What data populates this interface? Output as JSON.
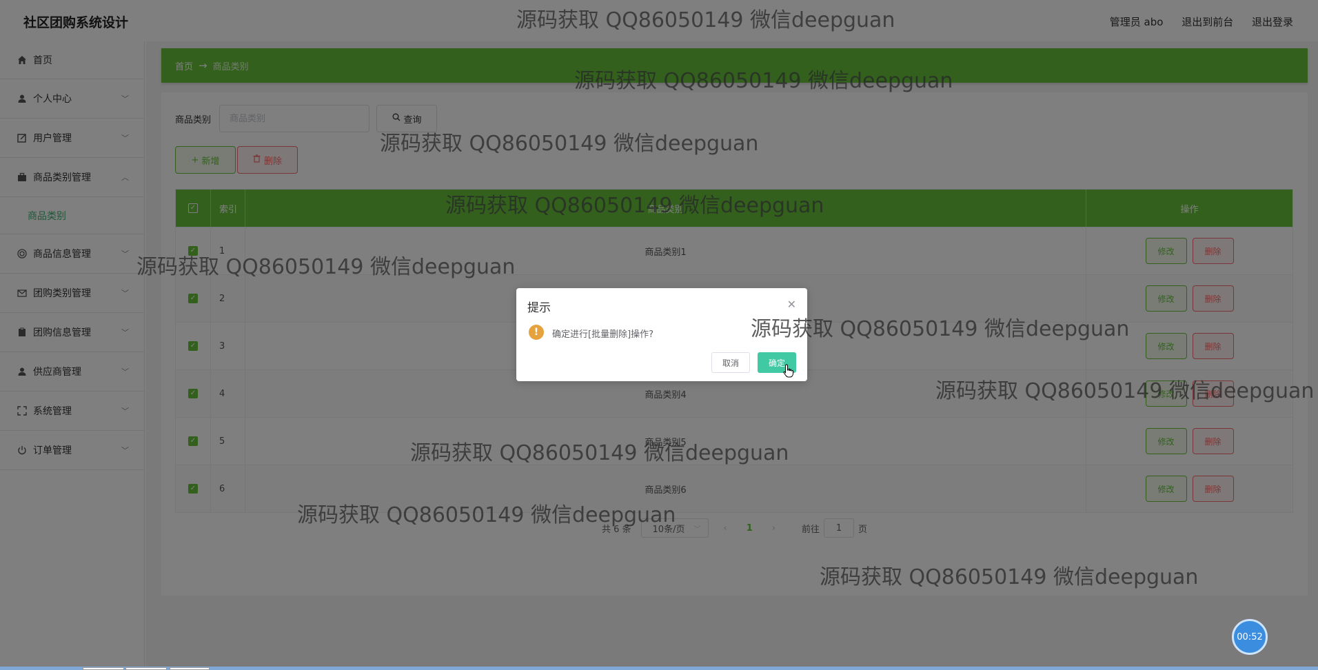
{
  "header": {
    "brand": "社区团购系统设计",
    "admin": "管理员 abo",
    "to_front": "退出到前台",
    "logout": "退出登录"
  },
  "sidebar": {
    "items": [
      {
        "label": "首页",
        "icon": "home-icon"
      },
      {
        "label": "个人中心",
        "icon": "user-icon"
      },
      {
        "label": "用户管理",
        "icon": "edit-icon"
      },
      {
        "label": "商品类别管理",
        "icon": "briefcase-icon",
        "expanded": true,
        "children": [
          {
            "label": "商品类别"
          }
        ]
      },
      {
        "label": "商品信息管理",
        "icon": "coin-icon"
      },
      {
        "label": "团购类别管理",
        "icon": "mail-icon"
      },
      {
        "label": "团购信息管理",
        "icon": "clipboard-icon"
      },
      {
        "label": "供应商管理",
        "icon": "user-icon"
      },
      {
        "label": "系统管理",
        "icon": "fullscreen-icon"
      },
      {
        "label": "订单管理",
        "icon": "power-icon"
      }
    ]
  },
  "breadcrumb": {
    "home": "首页",
    "current": "商品类别"
  },
  "search": {
    "label": "商品类别",
    "placeholder": "商品类别",
    "button": "查询"
  },
  "actions": {
    "add": "新增",
    "delete": "删除"
  },
  "table": {
    "headers": [
      "索引",
      "商品类别",
      "操作"
    ],
    "rows": [
      {
        "index": "1",
        "name": "商品类别1"
      },
      {
        "index": "2",
        "name": ""
      },
      {
        "index": "3",
        "name": ""
      },
      {
        "index": "4",
        "name": "商品类别4"
      },
      {
        "index": "5",
        "name": "商品类别5"
      },
      {
        "index": "6",
        "name": "商品类别6"
      }
    ],
    "edit_label": "修改",
    "delete_label": "删除"
  },
  "pager": {
    "total": "共 6 条",
    "page_size": "10条/页",
    "current_page": "1",
    "goto": "前往",
    "jump_value": "1",
    "page_unit": "页"
  },
  "dialog": {
    "title": "提示",
    "message": "确定进行[批量删除]操作?",
    "cancel": "取消",
    "confirm": "确定"
  },
  "watermark": "源码获取 QQ86050149 微信deepguan",
  "timer": "00:52",
  "colors": {
    "accent": "#67c23a",
    "danger": "#f56c6c",
    "confirm": "#40c9a2",
    "warning": "#e6a23c"
  }
}
